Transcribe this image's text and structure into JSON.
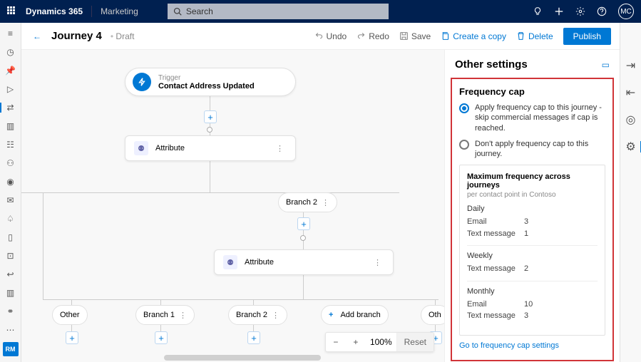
{
  "topnav": {
    "brand": "Dynamics 365",
    "app": "Marketing",
    "searchPlaceholder": "Search",
    "avatar": "MC"
  },
  "header": {
    "title": "Journey 4",
    "state": "Draft",
    "undo": "Undo",
    "redo": "Redo",
    "save": "Save",
    "copy": "Create a copy",
    "delete": "Delete",
    "publish": "Publish"
  },
  "panel": {
    "title": "Other settings",
    "freq": {
      "heading": "Frequency cap",
      "optApply": "Apply frequency cap to this journey - skip commercial messages if cap is reached.",
      "optSkip": "Don't apply frequency cap to this journey.",
      "maxHeading": "Maximum frequency across journeys",
      "maxSub": "per contact point in Contoso",
      "daily": "Daily",
      "weekly": "Weekly",
      "monthly": "Monthly",
      "rows": {
        "dailyEmail": {
          "k": "Email",
          "v": "3"
        },
        "dailyText": {
          "k": "Text message",
          "v": "1"
        },
        "weeklyText": {
          "k": "Text message",
          "v": "2"
        },
        "monthlyEmail": {
          "k": "Email",
          "v": "10"
        },
        "monthlyText": {
          "k": "Text message",
          "v": "3"
        }
      },
      "link": "Go to frequency cap settings"
    }
  },
  "canvas": {
    "triggerLabel": "Trigger",
    "triggerValue": "Contact Address Updated",
    "attribute": "Attribute",
    "branch1": "Branch 1",
    "branch2": "Branch 2",
    "other": "Other",
    "oth": "Oth",
    "addBranch": "Add branch",
    "zoom": "100%",
    "reset": "Reset"
  },
  "apptag": "RM"
}
